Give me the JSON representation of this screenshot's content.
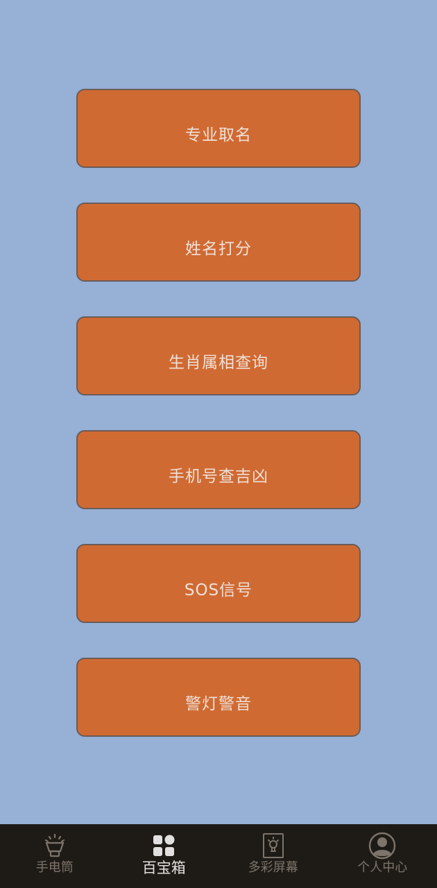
{
  "menu": {
    "items": [
      {
        "label": "专业取名"
      },
      {
        "label": "姓名打分"
      },
      {
        "label": "生肖属相查询"
      },
      {
        "label": "手机号查吉凶"
      },
      {
        "label": "SOS信号"
      },
      {
        "label": "警灯警音"
      }
    ]
  },
  "bottom_nav": {
    "active": "百宝箱",
    "items": [
      {
        "label": "手电筒",
        "icon": "flashlight-icon"
      },
      {
        "label": "百宝箱",
        "icon": "grid-icon"
      },
      {
        "label": "多彩屏幕",
        "icon": "bulb-screen-icon"
      },
      {
        "label": "个人中心",
        "icon": "profile-icon"
      }
    ]
  },
  "colors": {
    "background": "#96b0d6",
    "button_fill": "#d06a33",
    "button_text": "#f1e1d6",
    "nav_background": "#1e1b16",
    "nav_inactive": "#7d746c",
    "nav_active": "#e2e0de"
  }
}
